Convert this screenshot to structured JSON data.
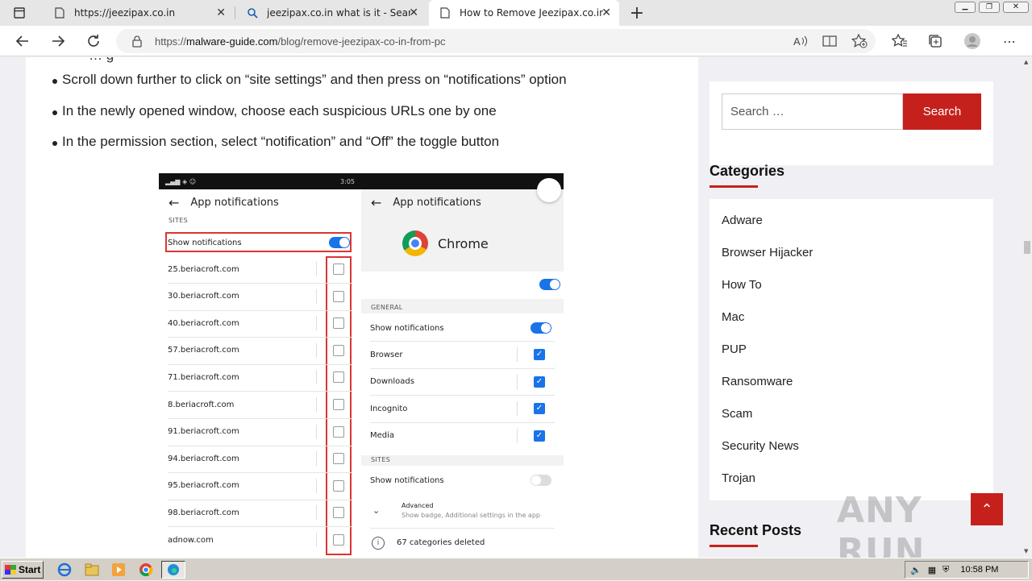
{
  "browser": {
    "tabs": [
      {
        "label": "https://jeezipax.co.in",
        "icon": "page-icon"
      },
      {
        "label": "jeezipax.co.in what is it - Search",
        "icon": "search-icon"
      },
      {
        "label": "How to Remove Jeezipax.co.in f",
        "icon": "page-icon"
      }
    ],
    "url_prefix": "https://",
    "url_host": "malware-guide.com",
    "url_path": "/blog/remove-jeezipax-co-in-from-pc"
  },
  "article": {
    "partial_line": "… g",
    "bullets": [
      "Scroll down further to click on “site settings” and then press on “notifications” option",
      "In the newly opened window, choose each suspicious URLs one by one",
      "In the permission section, select “notification” and “Off” the toggle button"
    ]
  },
  "phone_left": {
    "status_time": "3:05",
    "header": "App notifications",
    "sites_label": "SITES",
    "show_notifications": "Show notifications",
    "sites": [
      "25.beriacroft.com",
      "30.beriacroft.com",
      "40.beriacroft.com",
      "57.beriacroft.com",
      "71.beriacroft.com",
      "8.beriacroft.com",
      "91.beriacroft.com",
      "94.beriacroft.com",
      "95.beriacroft.com",
      "98.beriacroft.com",
      "adnow.com"
    ]
  },
  "phone_right": {
    "header": "App notifications",
    "app_name": "Chrome",
    "general_label": "GENERAL",
    "show_notifications": "Show notifications",
    "channels": [
      "Browser",
      "Downloads",
      "Incognito",
      "Media"
    ],
    "sites_label": "SITES",
    "sites_show_notifications": "Show notifications",
    "advanced_title": "Advanced",
    "advanced_sub": "Show badge, Additional settings in the app",
    "deleted_text": "67 categories deleted"
  },
  "sidebar": {
    "search_placeholder": "Search …",
    "search_button": "Search",
    "categories_title": "Categories",
    "categories": [
      "Adware",
      "Browser Hijacker",
      "How To",
      "Mac",
      "PUP",
      "Ransomware",
      "Scam",
      "Security News",
      "Trojan"
    ],
    "recent_posts_title": "Recent Posts"
  },
  "watermark": "ANY RUN",
  "taskbar": {
    "start_label": "Start",
    "clock": "10:58 PM"
  },
  "colors": {
    "accent": "#c6201c",
    "toggle": "#1a73e8"
  }
}
